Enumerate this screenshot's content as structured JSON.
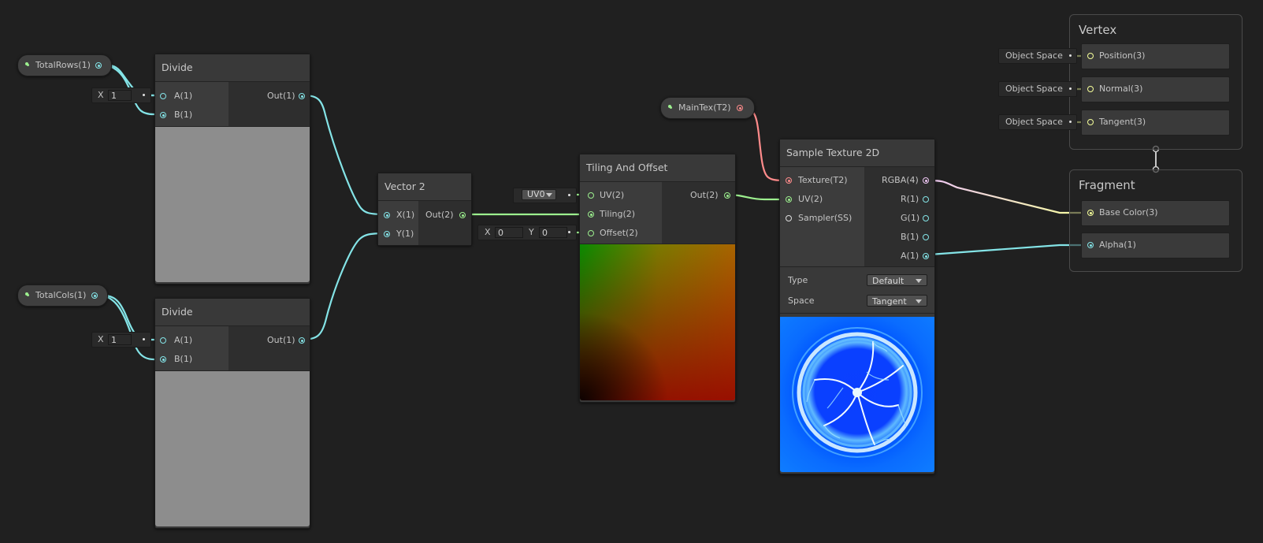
{
  "properties": {
    "total_rows": "TotalRows(1)",
    "total_cols": "TotalCols(1)",
    "main_tex": "MainTex(T2)"
  },
  "divide_top": {
    "title": "Divide",
    "inputs": [
      "A(1)",
      "B(1)"
    ],
    "output": "Out(1)",
    "field_label": "X",
    "field_value": "1"
  },
  "divide_bottom": {
    "title": "Divide",
    "inputs": [
      "A(1)",
      "B(1)"
    ],
    "output": "Out(1)",
    "field_label": "X",
    "field_value": "1"
  },
  "vector2": {
    "title": "Vector 2",
    "inputs": [
      "X(1)",
      "Y(1)"
    ],
    "output": "Out(2)"
  },
  "tiling": {
    "title": "Tiling And Offset",
    "inputs": [
      "UV(2)",
      "Tiling(2)",
      "Offset(2)"
    ],
    "output": "Out(2)",
    "uv_option": "UV0",
    "offset_x_label": "X",
    "offset_x": "0",
    "offset_y_label": "Y",
    "offset_y": "0"
  },
  "sample": {
    "title": "Sample Texture 2D",
    "inputs": [
      "Texture(T2)",
      "UV(2)",
      "Sampler(SS)"
    ],
    "outputs": [
      "RGBA(4)",
      "R(1)",
      "G(1)",
      "B(1)",
      "A(1)"
    ],
    "type_label": "Type",
    "type_value": "Default",
    "space_label": "Space",
    "space_value": "Tangent"
  },
  "vertex": {
    "title": "Vertex",
    "blocks": [
      {
        "space": "Object Space",
        "label": "Position(3)"
      },
      {
        "space": "Object Space",
        "label": "Normal(3)"
      },
      {
        "space": "Object Space",
        "label": "Tangent(3)"
      }
    ]
  },
  "fragment": {
    "title": "Fragment",
    "blocks": [
      {
        "label": "Base Color(3)"
      },
      {
        "label": "Alpha(1)"
      }
    ]
  },
  "colors": {
    "background": "#202020",
    "float_port": "#84e4e7",
    "vector2_port": "#9cef8e",
    "texture_port": "#ff8b8b",
    "vector3_port": "#f6ff9a",
    "vector4_port": "#eec7f4"
  }
}
